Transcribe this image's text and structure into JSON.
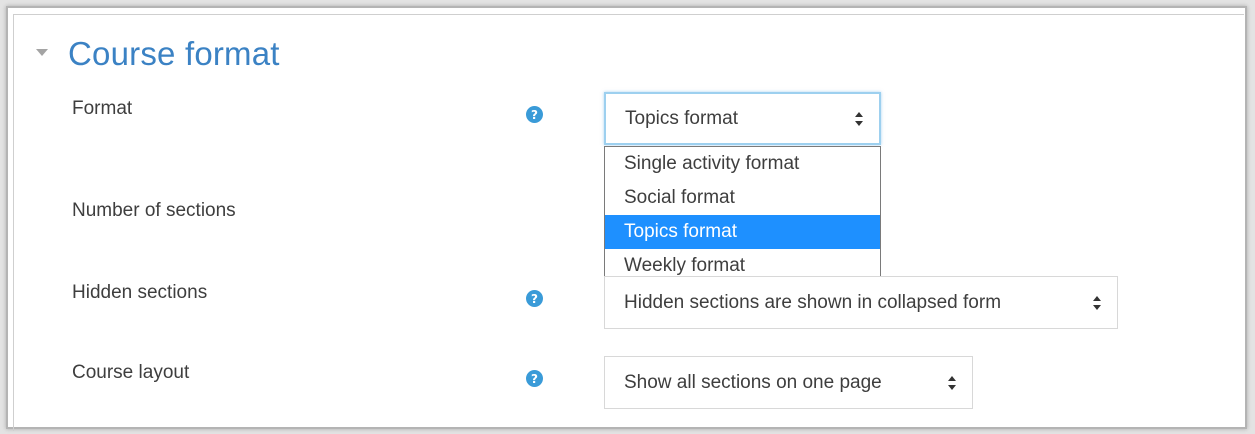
{
  "section": {
    "title": "Course format"
  },
  "fields": {
    "format": {
      "label": "Format",
      "selected": "Topics format",
      "options": [
        "Single activity format",
        "Social format",
        "Topics format",
        "Weekly format"
      ]
    },
    "sections": {
      "label": "Number of sections"
    },
    "hidden": {
      "label": "Hidden sections",
      "selected": "Hidden sections are shown in collapsed form"
    },
    "layout": {
      "label": "Course layout",
      "selected": "Show all sections on one page"
    }
  },
  "icons": {
    "help": "?",
    "collapse": "chevron-down-icon"
  },
  "colors": {
    "accent": "#3b82c4",
    "help_icon": "#3a9bd8",
    "highlight": "#1e90ff"
  }
}
